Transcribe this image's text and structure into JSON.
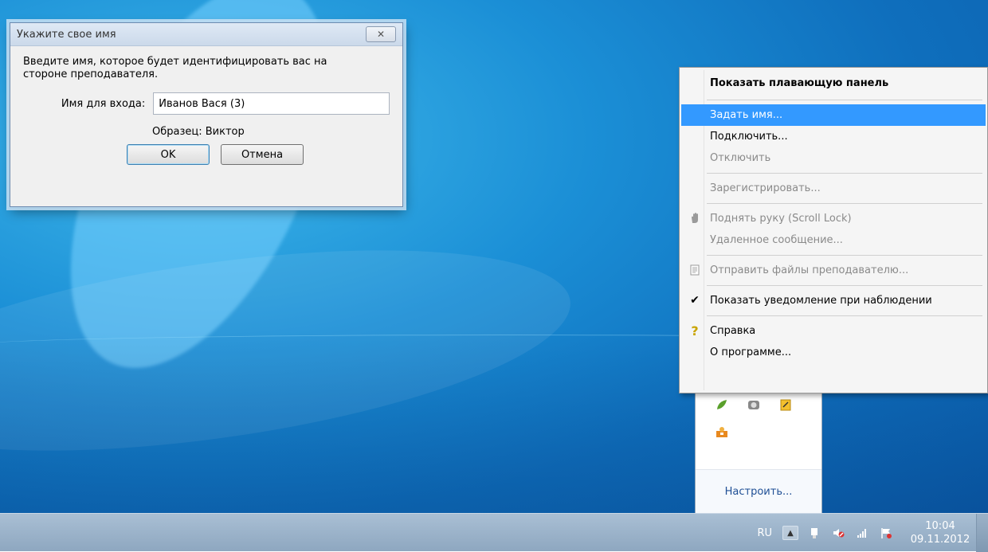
{
  "dialog": {
    "title": "Укажите свое имя",
    "close_glyph": "✕",
    "description": "Введите имя, которое будет идентифицировать вас на стороне преподавателя.",
    "name_label": "Имя для входа:",
    "name_value": "Иванов Вася (3)",
    "hint": "Образец: Виктор",
    "ok_label": "OK",
    "cancel_label": "Отмена"
  },
  "menu": {
    "items": [
      {
        "label": "Показать плавающую панель",
        "state": "bold"
      },
      {
        "label": "Задать имя...",
        "state": "highlighted"
      },
      {
        "label": "Подключить...",
        "state": "normal"
      },
      {
        "label": "Отключить",
        "state": "disabled"
      },
      {
        "label": "Зарегистрировать...",
        "state": "disabled"
      },
      {
        "label": "Поднять руку (Scroll Lock)",
        "state": "disabled",
        "icon": "hand-icon"
      },
      {
        "label": "Удаленное сообщение...",
        "state": "disabled"
      },
      {
        "label": "Отправить файлы преподавателю...",
        "state": "disabled",
        "icon": "document-icon"
      },
      {
        "label": "Показать уведомление при наблюдении",
        "state": "checked",
        "icon": "check-icon"
      },
      {
        "label": "Справка",
        "state": "normal",
        "icon": "help-icon"
      },
      {
        "label": "О программе...",
        "state": "normal"
      }
    ]
  },
  "tray_panel": {
    "customize_label": "Настроить..."
  },
  "taskbar": {
    "language": "RU",
    "time": "10:04",
    "date": "09.11.2012"
  },
  "colors": {
    "menu_highlight": "#3399ff",
    "desktop": "#1b8fd6"
  }
}
